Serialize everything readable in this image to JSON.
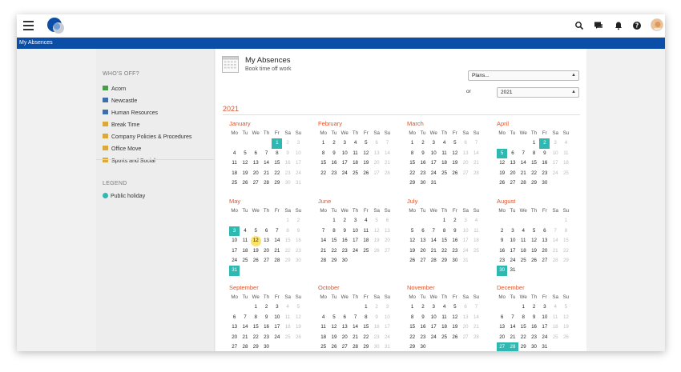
{
  "app": {
    "breadcrumb": "My Absences",
    "colors": {
      "brand_blue": "#0b4ea8",
      "accent_orange": "#e2532a",
      "public_holiday": "#2fb7b2",
      "today": "#fbe36a"
    },
    "icons": [
      "menu-icon",
      "search-icon",
      "chat-icon",
      "bell-icon",
      "help-icon"
    ]
  },
  "sidebar": {
    "whos_off_heading": "WHO'S OFF?",
    "items": [
      {
        "label": "Acorn",
        "color": "#4c9a4c"
      },
      {
        "label": "Newcastle",
        "color": "#3e6ea8"
      },
      {
        "label": "Human Resources",
        "color": "#3e6ea8"
      },
      {
        "label": "Break Time",
        "color": "#d9a93b"
      },
      {
        "label": "Company Policies & Procedures",
        "color": "#d9a93b"
      },
      {
        "label": "Office Move",
        "color": "#d9a93b"
      },
      {
        "label": "Sports and Social",
        "color": "#d9a93b"
      }
    ],
    "legend_heading": "LEGEND",
    "legend_items": [
      {
        "label": "Public holiday",
        "color": "#2fb7b2"
      }
    ]
  },
  "main": {
    "title": "My Absences",
    "subtitle": "Book time off work",
    "plans_select": "Plans...",
    "or_label": "or",
    "year_select": "2021",
    "year_heading": "2021"
  },
  "calendar": {
    "weekdays": [
      "Mo",
      "Tu",
      "We",
      "Th",
      "Fr",
      "Sa",
      "Su"
    ],
    "months": [
      {
        "name": "January",
        "offset": 4,
        "days": 31,
        "holidays": [
          1
        ],
        "today": null
      },
      {
        "name": "February",
        "offset": 0,
        "days": 28,
        "holidays": [],
        "today": null
      },
      {
        "name": "March",
        "offset": 0,
        "days": 31,
        "holidays": [],
        "today": null
      },
      {
        "name": "April",
        "offset": 3,
        "days": 30,
        "holidays": [
          2,
          5
        ],
        "today": null
      },
      {
        "name": "May",
        "offset": 5,
        "days": 31,
        "holidays": [
          3,
          31
        ],
        "today": 12
      },
      {
        "name": "June",
        "offset": 1,
        "days": 30,
        "holidays": [],
        "today": null
      },
      {
        "name": "July",
        "offset": 3,
        "days": 31,
        "holidays": [],
        "today": null
      },
      {
        "name": "August",
        "offset": 6,
        "days": 31,
        "holidays": [
          30
        ],
        "today": null
      },
      {
        "name": "September",
        "offset": 2,
        "days": 30,
        "holidays": [],
        "today": null
      },
      {
        "name": "October",
        "offset": 4,
        "days": 31,
        "holidays": [],
        "today": null
      },
      {
        "name": "November",
        "offset": 0,
        "days": 30,
        "holidays": [],
        "today": null
      },
      {
        "name": "December",
        "offset": 2,
        "days": 31,
        "holidays": [
          27,
          28
        ],
        "today": null
      }
    ]
  }
}
